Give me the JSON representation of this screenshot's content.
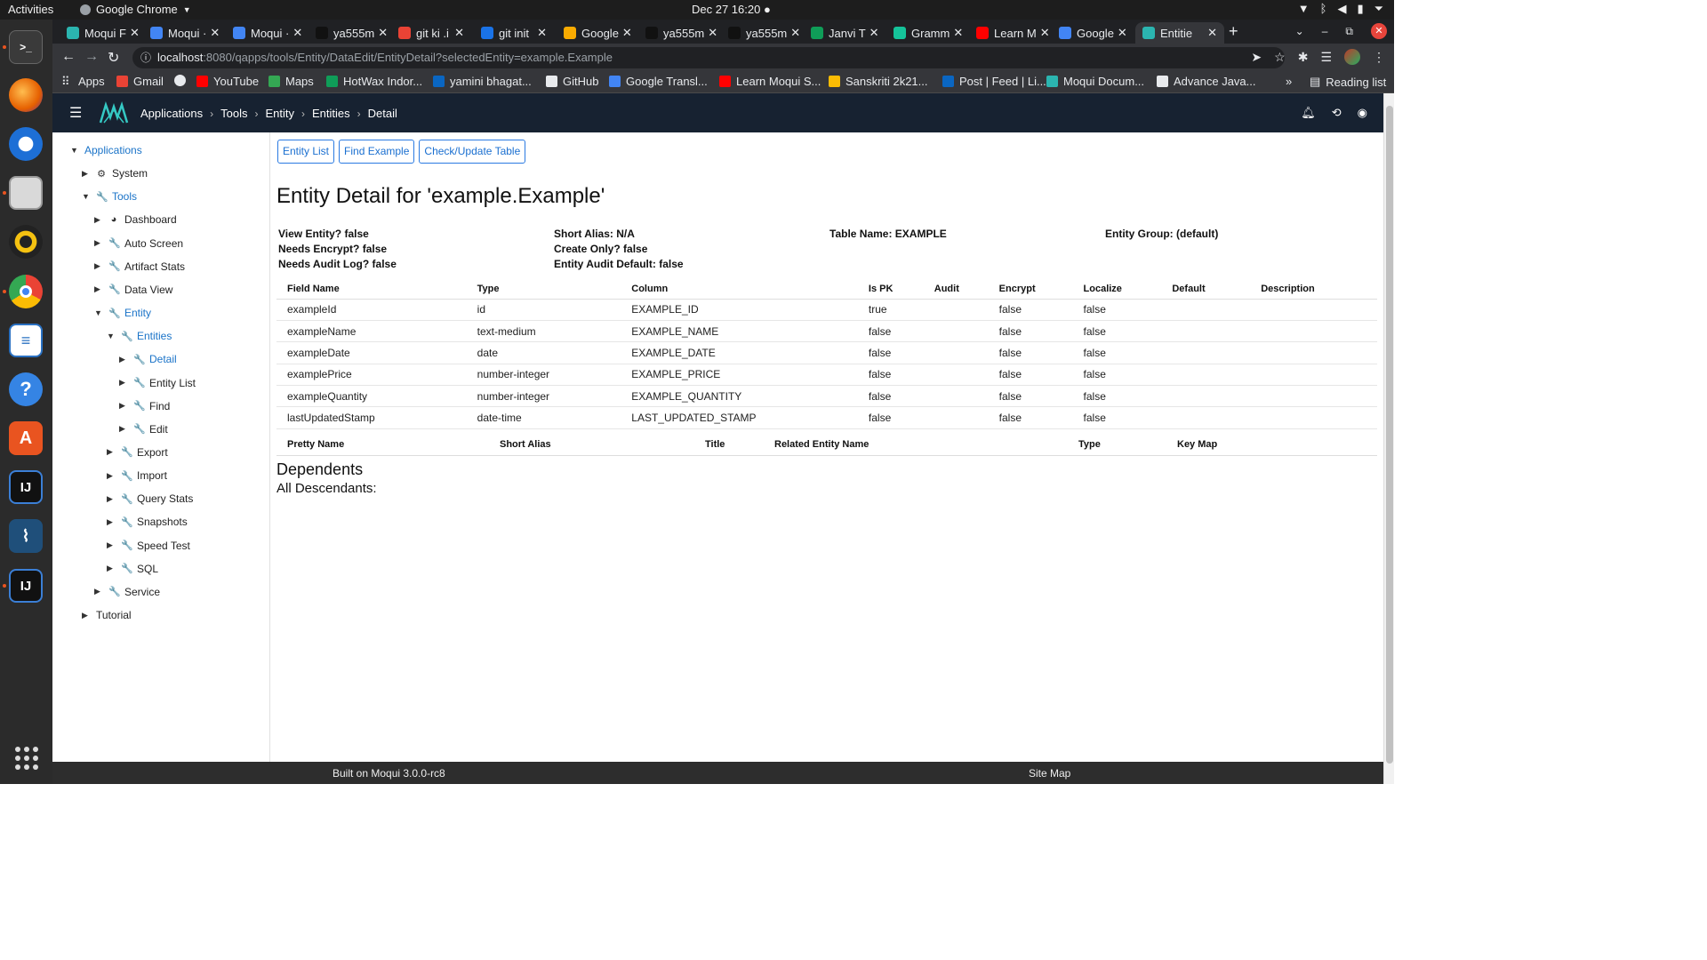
{
  "os": {
    "activities": "Activities",
    "app_name": "Google Chrome",
    "clock": "Dec 27  16:20"
  },
  "tabs": [
    {
      "label": "Moqui F",
      "color": "#2bb5b0"
    },
    {
      "label": "Moqui ·",
      "color": "#4285f4"
    },
    {
      "label": "Moqui ·",
      "color": "#4285f4"
    },
    {
      "label": "ya555m",
      "color": "#111111"
    },
    {
      "label": "git ki .i",
      "color": "#ea4335"
    },
    {
      "label": "git init",
      "color": "#1a73e8"
    },
    {
      "label": "Google",
      "color": "#f9ab00"
    },
    {
      "label": "ya555m",
      "color": "#111111"
    },
    {
      "label": "ya555m",
      "color": "#111111"
    },
    {
      "label": "Janvi T",
      "color": "#0f9d58"
    },
    {
      "label": "Gramm",
      "color": "#15c39a"
    },
    {
      "label": "Learn M",
      "color": "#ff0000"
    },
    {
      "label": "Google",
      "color": "#4285f4"
    },
    {
      "label": "Entitie",
      "color": "#2bb5b0"
    }
  ],
  "address": {
    "host": "localhost",
    "path": ":8080/qapps/tools/Entity/DataEdit/EntityDetail?selectedEntity=example.Example"
  },
  "bookmarks": [
    {
      "label": "Apps",
      "color": "#e8eaed"
    },
    {
      "label": "Gmail",
      "color": "#ea4335"
    },
    {
      "label": "",
      "color": "#e8eaed"
    },
    {
      "label": "YouTube",
      "color": "#ff0000"
    },
    {
      "label": "Maps",
      "color": "#34a853"
    },
    {
      "label": "HotWax Indor...",
      "color": "#0f9d58"
    },
    {
      "label": "yamini bhagat...",
      "color": "#0a66c2"
    },
    {
      "label": "GitHub",
      "color": "#e8eaed"
    },
    {
      "label": "Google Transl...",
      "color": "#4285f4"
    },
    {
      "label": "Learn Moqui S...",
      "color": "#ff0000"
    },
    {
      "label": "Sanskriti 2k21...",
      "color": "#fbbc04"
    },
    {
      "label": "Post | Feed | Li...",
      "color": "#0a66c2"
    },
    {
      "label": "Moqui Docum...",
      "color": "#2bb5b0"
    },
    {
      "label": "Advance Java...",
      "color": "#e8eaed"
    }
  ],
  "bookmarks_more": "»",
  "reading_list": "Reading list",
  "header": {
    "breadcrumbs": [
      "Applications",
      "Tools",
      "Entity",
      "Entities",
      "Detail"
    ]
  },
  "sidebar": {
    "items": [
      {
        "label": "Applications",
        "caret": "▼",
        "icon": "",
        "link": true
      },
      {
        "label": "System",
        "caret": "▶",
        "icon": "⚙",
        "link": false
      },
      {
        "label": "Tools",
        "caret": "▼",
        "icon": "🔧",
        "link": true
      },
      {
        "label": "Dashboard",
        "caret": "▶",
        "icon": "◕",
        "link": false
      },
      {
        "label": "Auto Screen",
        "caret": "▶",
        "icon": "🔧",
        "link": false
      },
      {
        "label": "Artifact Stats",
        "caret": "▶",
        "icon": "🔧",
        "link": false
      },
      {
        "label": "Data View",
        "caret": "▶",
        "icon": "🔧",
        "link": false
      },
      {
        "label": "Entity",
        "caret": "▼",
        "icon": "🔧",
        "link": true
      },
      {
        "label": "Entities",
        "caret": "▼",
        "icon": "🔧",
        "link": true
      },
      {
        "label": "Detail",
        "caret": "▶",
        "icon": "🔧",
        "link": true
      },
      {
        "label": "Entity List",
        "caret": "▶",
        "icon": "🔧",
        "link": false
      },
      {
        "label": "Find",
        "caret": "▶",
        "icon": "🔧",
        "link": false
      },
      {
        "label": "Edit",
        "caret": "▶",
        "icon": "🔧",
        "link": false
      },
      {
        "label": "Export",
        "caret": "▶",
        "icon": "🔧",
        "link": false
      },
      {
        "label": "Import",
        "caret": "▶",
        "icon": "🔧",
        "link": false
      },
      {
        "label": "Query Stats",
        "caret": "▶",
        "icon": "🔧",
        "link": false
      },
      {
        "label": "Snapshots",
        "caret": "▶",
        "icon": "🔧",
        "link": false
      },
      {
        "label": "Speed Test",
        "caret": "▶",
        "icon": "🔧",
        "link": false
      },
      {
        "label": "SQL",
        "caret": "▶",
        "icon": "🔧",
        "link": false
      },
      {
        "label": "Service",
        "caret": "▶",
        "icon": "🔧",
        "link": false
      },
      {
        "label": "Tutorial",
        "caret": "▶",
        "icon": "",
        "link": false
      }
    ]
  },
  "main": {
    "buttons": [
      "Entity List",
      "Find Example",
      "Check/Update Table"
    ],
    "title": "Entity Detail for 'example.Example'",
    "properties": [
      [
        "View Entity? false",
        "Short Alias: N/A",
        "Table Name: EXAMPLE",
        "Entity Group: (default)"
      ],
      [
        "Needs Encrypt? false",
        "Create Only? false",
        "",
        ""
      ],
      [
        "Needs Audit Log? false",
        "Entity Audit Default: false",
        "",
        ""
      ]
    ],
    "field_columns": [
      "Field Name",
      "Type",
      "Column",
      "Is PK",
      "Audit",
      "Encrypt",
      "Localize",
      "Default",
      "Description"
    ],
    "fields": [
      [
        "exampleId",
        "id",
        "EXAMPLE_ID",
        "true",
        "",
        "false",
        "false",
        "",
        ""
      ],
      [
        "exampleName",
        "text-medium",
        "EXAMPLE_NAME",
        "false",
        "",
        "false",
        "false",
        "",
        ""
      ],
      [
        "exampleDate",
        "date",
        "EXAMPLE_DATE",
        "false",
        "",
        "false",
        "false",
        "",
        ""
      ],
      [
        "examplePrice",
        "number-integer",
        "EXAMPLE_PRICE",
        "false",
        "",
        "false",
        "false",
        "",
        ""
      ],
      [
        "exampleQuantity",
        "number-integer",
        "EXAMPLE_QUANTITY",
        "false",
        "",
        "false",
        "false",
        "",
        ""
      ],
      [
        "lastUpdatedStamp",
        "date-time",
        "LAST_UPDATED_STAMP",
        "false",
        "",
        "false",
        "false",
        "",
        ""
      ]
    ],
    "relation_columns": [
      "Pretty Name",
      "Short Alias",
      "Title",
      "Related Entity Name",
      "Type",
      "Key Map"
    ],
    "dependents_title": "Dependents",
    "all_descendants": "All Descendants:"
  },
  "footer": {
    "built_on": "Built on Moqui 3.0.0-rc8",
    "site_map": "Site Map"
  }
}
